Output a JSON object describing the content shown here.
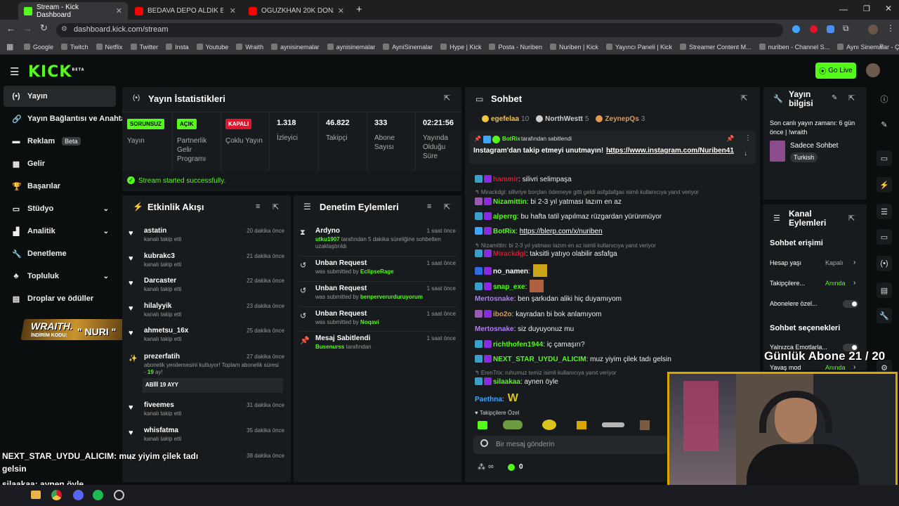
{
  "browser": {
    "tabs": [
      {
        "title": "Stream - Kick Dashboard",
        "icon": "kick-icon"
      },
      {
        "title": "BEDAVA DEPO ALDIK BUNLAR",
        "icon": "youtube-icon"
      },
      {
        "title": "OGUZKHAN 20K DONATE ALIYO",
        "icon": "youtube-icon"
      }
    ],
    "url": "dashboard.kick.com/stream",
    "bookmarks": [
      "Google",
      "Twitch",
      "Netflix",
      "Twitter",
      "Insta",
      "Youtube",
      "Wraith",
      "aynisinemalar",
      "aynisinemalar",
      "AyniSinemalar",
      "Hype | Kick",
      "Posta - Nuriben",
      "Nuriben | Kick",
      "Yayıncı Paneli | Kick",
      "Streamer Content M...",
      "nuriben - Channel S...",
      "Aynı Sinemalar - Ça..."
    ]
  },
  "header": {
    "logo": "KICK",
    "logo_sup": "BETA",
    "go_live": "Go Live"
  },
  "sidebar": {
    "items": [
      {
        "label": "Yayın",
        "icon": "broadcast-icon"
      },
      {
        "label": "Yayın Bağlantısı ve Anahtar",
        "icon": "link-icon"
      },
      {
        "label": "Reklam",
        "icon": "ad-icon",
        "badge": "Beta"
      },
      {
        "label": "Gelir",
        "icon": "revenue-icon"
      },
      {
        "label": "Başarılar",
        "icon": "trophy-icon"
      },
      {
        "label": "Stüdyo",
        "icon": "studio-icon"
      },
      {
        "label": "Analitik",
        "icon": "analytics-icon"
      },
      {
        "label": "Denetleme",
        "icon": "wrench-icon"
      },
      {
        "label": "Topluluk",
        "icon": "community-icon"
      },
      {
        "label": "Droplar ve ödüller",
        "icon": "drops-icon"
      }
    ],
    "promo": {
      "brand": "WRAITH.",
      "code_label": "İNDİRİM KODU:",
      "code": "\" NURI \""
    }
  },
  "stats": {
    "title": "Yayın İstatistikleri",
    "badges": [
      {
        "badge": "SORUNSUZ",
        "label": "Yayın",
        "color": "#53fc18"
      },
      {
        "badge": "AÇIK",
        "label": "Partnerlik Gelir Programı",
        "color": "#53fc18"
      },
      {
        "badge": "KAPALI",
        "label": "Çoklu Yayın",
        "color": "#e0142a"
      }
    ],
    "numbers": [
      {
        "value": "1.318",
        "label": "İzleyici"
      },
      {
        "value": "46.822",
        "label": "Takipçi"
      },
      {
        "value": "333",
        "label": "Abone Sayısı"
      },
      {
        "value": "02:21:56",
        "label": "Yayında Olduğu Süre"
      }
    ],
    "status": "Stream started successfully."
  },
  "activity": {
    "title": "Etkinlik Akışı",
    "items": [
      {
        "name": "astatin",
        "sub": "kanalı takip etti",
        "time": "20 dakika önce"
      },
      {
        "name": "kubrakc3",
        "sub": "kanalı takip etti",
        "time": "21 dakika önce"
      },
      {
        "name": "Darcaster",
        "sub": "kanalı takip etti",
        "time": "22 dakika önce"
      },
      {
        "name": "hilalyyik",
        "sub": "kanalı takip etti",
        "time": "23 dakika önce"
      },
      {
        "name": "ahmetsu_16x",
        "sub": "kanalı takip etti",
        "time": "25 dakika önce"
      }
    ],
    "resub": {
      "name": "prezerfatih",
      "time": "27 dakika önce",
      "text": "abonelik yenilemesini kutluyor! Toplam abonelik süresi -",
      "months": "19",
      "months_suffix": "ay!",
      "reply": "ABİİİ 19 AYY"
    },
    "items2": [
      {
        "name": "fiveemes",
        "sub": "kanalı takip etti",
        "time": "31 dakika önce"
      },
      {
        "name": "whisfatma",
        "sub": "kanalı takip etti",
        "time": "35 dakika önce"
      },
      {
        "name": "",
        "sub": "",
        "time": "38 dakika önce"
      }
    ]
  },
  "moderation": {
    "title": "Denetim Eylemleri",
    "items": [
      {
        "name": "Ardyno",
        "user": "utku1907",
        "sub": "tarafından 5 dakika süreliğine sohbetten uzaklaştırıldı",
        "time": "1 saat önce"
      },
      {
        "name": "Unban Request",
        "sub": "was submitted by",
        "user": "EclipseRage",
        "time": "1 saat önce"
      },
      {
        "name": "Unban Request",
        "sub": "was submitted by",
        "user": "benperverurduruyorum",
        "time": "1 saat önce"
      },
      {
        "name": "Unban Request",
        "sub": "was submitted by",
        "user": "Noqavi",
        "time": "1 saat önce"
      },
      {
        "name": "Mesaj Sabitlendi",
        "user": "Busenurss",
        "sub": "tarafından",
        "time": "1 saat önce"
      }
    ]
  },
  "chat": {
    "title": "Sohbet",
    "top_gifters": [
      {
        "name": "egefelaa",
        "count": "10",
        "color": "#f5c542"
      },
      {
        "name": "NorthWestt",
        "count": "5",
        "color": "#cfcfcf"
      },
      {
        "name": "ZeynepQs",
        "count": "3",
        "color": "#e09a4f"
      }
    ],
    "pinned": {
      "by": "BotRix",
      "by_suffix": "tarafından sabitlendi",
      "text": "Instagram'dan takip etmeyi unutmayın! →",
      "link": "https://www.instagram.com/Nuriben41"
    },
    "messages": [
      {
        "user": "hammir",
        "color": "#e0142a",
        "text": ": silivri selimpaşa",
        "badge": "31"
      },
      {
        "reply": "↰ Mirackdgl: sillvriye borçları ödemeye gitti geldi asfgdafgas isimli kullanıcıya yanıt veriyor"
      },
      {
        "user": "Nizamittin",
        "color": "#53fc18",
        "text": ": bi 2-3 yıl yatması lazım en az",
        "badge": "28"
      },
      {
        "user": "alperrg",
        "color": "#53fc18",
        "text": ": bu hafta tatil yapılmaz rüzgardan yürünmüyor",
        "badge": "31"
      },
      {
        "user": "BotRix",
        "color": "#53fc18",
        "text": ": ",
        "link": "https://blerp.com/x/nuriben",
        "badge": "bot"
      },
      {
        "reply": "↰ Nizamittin: bi 2-3 yıl yatması lazım en az isimli kullanıcıya yanıt veriyor"
      },
      {
        "user": "Mirackdgl",
        "color": "#e0142a",
        "text": ": taksitli yatıyo olabilir asfafga",
        "badge": "38"
      },
      {
        "user": "no_namen",
        "color": "#fff",
        "text": ":",
        "badge": "mod"
      },
      {
        "user": "snap_exe",
        "color": "#53fc18",
        "text": ":",
        "badge": "33"
      },
      {
        "user": "Mertosnake",
        "color": "#b37bff",
        "text": ": ben şarkıdan aliki hiç duyamıyom",
        "badge": ""
      },
      {
        "user": "ibo2o",
        "color": "#e09a4f",
        "text": ": kayradan bi bok anlamıyom",
        "badge": "20"
      },
      {
        "user": "Mertosnake",
        "color": "#b37bff",
        "text": ": siz duyuyonuz mu",
        "badge": ""
      },
      {
        "user": "richthofen1944",
        "color": "#53fc18",
        "text": ": iç çamaşırı?",
        "badge": "36"
      },
      {
        "user": "NEXT_STAR_UYDU_ALICIM",
        "color": "#53fc18",
        "text": ": muz yiyim çilek tadı gelsin",
        "badge": "36"
      },
      {
        "reply": "↰ ErenTrix: ruhumuz temiz isimli kullanıcıya yanıt veriyor"
      },
      {
        "user": "silaakaa",
        "color": "#53fc18",
        "text": ": aynen öyle",
        "badge": "36"
      },
      {
        "user": "Paethna",
        "color": "#3ea6ff",
        "text": ":",
        "badge": ""
      }
    ],
    "followers_only": "Takipçilere Özel",
    "input_placeholder": "Bir mesaj gönderin",
    "points": "0"
  },
  "stream_info": {
    "title": "Yayın bilgisi",
    "last_live": "Son canlı yayın zamanı: 6 gün önce | !wraith",
    "category": "Sadece Sohbet",
    "tag": "Turkish"
  },
  "channel_actions": {
    "title": "Kanal Eylemleri",
    "section1": "Sohbet erişimi",
    "rows": [
      {
        "label": "Hesap yaşı",
        "value": "Kapalı"
      },
      {
        "label": "Takipçilere...",
        "value": "Anında"
      },
      {
        "label": "Abonelere özel...",
        "value": ""
      }
    ],
    "section2": "Sohbet seçenekleri",
    "rows2": [
      {
        "label": "Yalnızca Emotlarla...",
        "value": ""
      },
      {
        "label": "Yavaş mod",
        "value": "Anında"
      }
    ]
  },
  "overlay": {
    "sub_goal": "Günlük Abone 21 / 20",
    "chat_lines": [
      {
        "user": "NEXT_STAR_UYDU_ALICIM",
        "text": ": muz yiyim çilek tadı gelsin"
      },
      {
        "user": "silaakaa",
        "text": ": aynen öyle"
      },
      {
        "user": "Paethna",
        "text": ": w"
      }
    ]
  }
}
